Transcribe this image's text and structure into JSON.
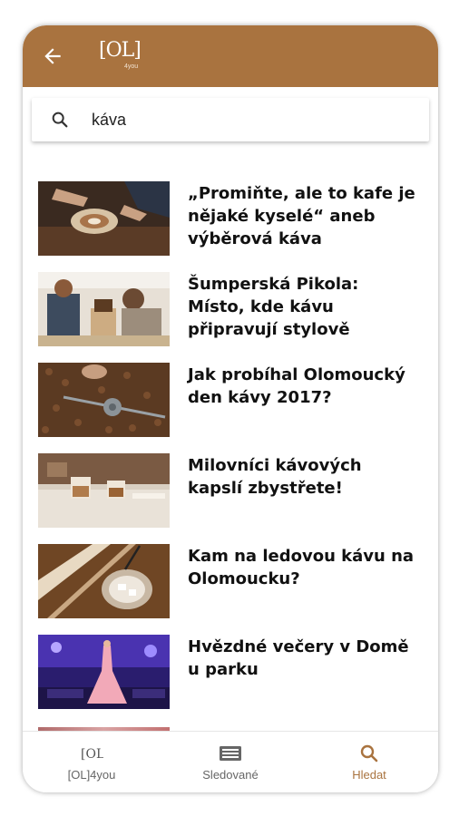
{
  "header": {
    "logo_text": "[OL]",
    "logo_sub": "4you",
    "accent": "#a9733f"
  },
  "search": {
    "value": "káva",
    "icon": "search-icon"
  },
  "articles": [
    {
      "title": "„Promiňte, ale to kafe je nějaké kyselé“ aneb výběrová káva"
    },
    {
      "title": "Šumperská Pikola: Místo, kde kávu připravují stylově"
    },
    {
      "title": "Jak probíhal Olomoucký den kávy 2017?"
    },
    {
      "title": "Milovníci kávových kapslí zbystřete!"
    },
    {
      "title": "Kam na ledovou kávu na Olomoucku?"
    },
    {
      "title": "Hvězdné večery v Domě u parku"
    }
  ],
  "bottom_nav": [
    {
      "label": "[OL]4you",
      "icon": "ol-logo-icon",
      "active": false
    },
    {
      "label": "Sledované",
      "icon": "newspaper-icon",
      "active": false
    },
    {
      "label": "Hledat",
      "icon": "search-icon",
      "active": true
    }
  ]
}
